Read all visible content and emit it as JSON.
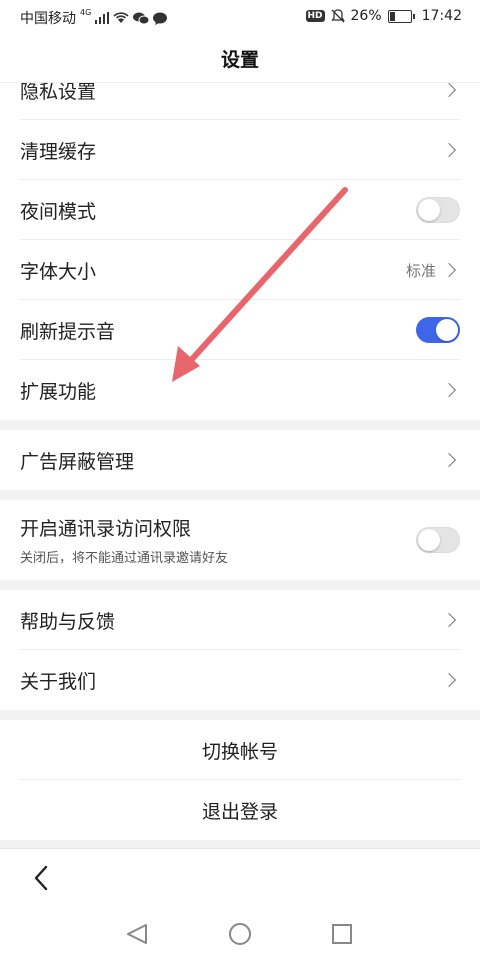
{
  "status_bar": {
    "carrier": "中国移动",
    "network": "4G",
    "battery_percent": "26%",
    "battery_level": 0.26,
    "time": "17:42",
    "hd_badge": "HD"
  },
  "header": {
    "title": "设置"
  },
  "settings": {
    "privacy": "隐私设置",
    "clear_cache": "清理缓存",
    "night_mode": "夜间模式",
    "font_size": "字体大小",
    "font_size_value": "标准",
    "refresh_sound": "刷新提示音",
    "extensions": "扩展功能",
    "ad_block": "广告屏蔽管理",
    "contacts_access": "开启通讯录访问权限",
    "contacts_access_desc": "关闭后，将不能通过通讯录邀请好友",
    "help_feedback": "帮助与反馈",
    "about_us": "关于我们",
    "switch_account": "切换帐号",
    "logout": "退出登录"
  },
  "toggles": {
    "night_mode": false,
    "refresh_sound": true,
    "contacts_access": false
  },
  "colors": {
    "accent": "#3f66e8",
    "annotation_arrow": "#e8656b"
  },
  "icons": [
    "chevron-right-icon",
    "back-arrow-icon",
    "nav-back-icon",
    "nav-home-icon",
    "nav-recents-icon",
    "signal-icon",
    "wifi-icon",
    "mute-icon"
  ]
}
